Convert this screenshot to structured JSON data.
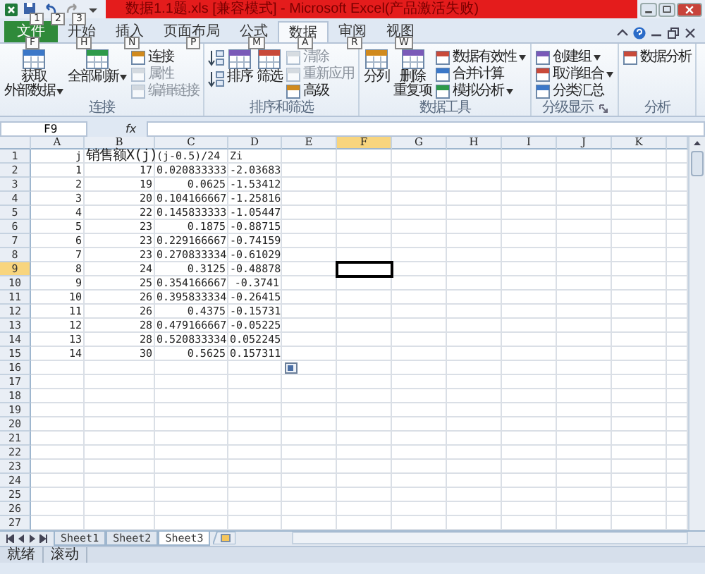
{
  "window": {
    "title": "数据1.1题.xls [兼容模式] - Microsoft Excel(产品激活失败)",
    "quick_access_keytips": [
      "1",
      "2",
      "3"
    ]
  },
  "ribbon_tabs": [
    {
      "label": "文件",
      "keytip": "F",
      "selected": false,
      "kind": "file"
    },
    {
      "label": "开始",
      "keytip": "H",
      "selected": false,
      "kind": "tab"
    },
    {
      "label": "插入",
      "keytip": "N",
      "selected": false,
      "kind": "tab"
    },
    {
      "label": "页面布局",
      "keytip": "P",
      "selected": false,
      "kind": "tab"
    },
    {
      "label": "公式",
      "keytip": "M",
      "selected": false,
      "kind": "tab"
    },
    {
      "label": "数据",
      "keytip": "A",
      "selected": true,
      "kind": "tab"
    },
    {
      "label": "审阅",
      "keytip": "R",
      "selected": false,
      "kind": "tab"
    },
    {
      "label": "视图",
      "keytip": "W",
      "selected": false,
      "kind": "tab"
    }
  ],
  "ribbon_groups": [
    {
      "label": "连接",
      "launcher": false,
      "items": [
        {
          "kind": "large",
          "lines": [
            "获取",
            "外部数据"
          ],
          "dropdown": true,
          "disabled": false
        },
        {
          "kind": "large",
          "lines": [
            "全部刷新"
          ],
          "dropdown": true,
          "disabled": false
        },
        {
          "kind": "small",
          "lines": [
            "连接"
          ],
          "dropdown": false,
          "disabled": false
        },
        {
          "kind": "small",
          "lines": [
            "属性"
          ],
          "dropdown": false,
          "disabled": true
        },
        {
          "kind": "small",
          "lines": [
            "编辑链接"
          ],
          "dropdown": false,
          "disabled": true
        }
      ]
    },
    {
      "label": "排序和筛选",
      "launcher": false,
      "items": [
        {
          "kind": "icon"
        },
        {
          "kind": "icon"
        },
        {
          "kind": "large",
          "lines": [
            "排序"
          ],
          "dropdown": false,
          "disabled": false
        },
        {
          "kind": "large",
          "lines": [
            "筛选"
          ],
          "dropdown": false,
          "disabled": false
        },
        {
          "kind": "small",
          "lines": [
            "清除"
          ],
          "dropdown": false,
          "disabled": true
        },
        {
          "kind": "small",
          "lines": [
            "重新应用"
          ],
          "dropdown": false,
          "disabled": true
        },
        {
          "kind": "small",
          "lines": [
            "高级"
          ],
          "dropdown": false,
          "disabled": false
        }
      ]
    },
    {
      "label": "数据工具",
      "launcher": false,
      "items": [
        {
          "kind": "large",
          "lines": [
            "分列"
          ],
          "dropdown": false,
          "disabled": false
        },
        {
          "kind": "large",
          "lines": [
            "删除",
            "重复项"
          ],
          "dropdown": false,
          "disabled": false
        },
        {
          "kind": "small",
          "lines": [
            "数据有效性"
          ],
          "dropdown": true,
          "disabled": false
        },
        {
          "kind": "small",
          "lines": [
            "合并计算"
          ],
          "dropdown": false,
          "disabled": false
        },
        {
          "kind": "small",
          "lines": [
            "模拟分析"
          ],
          "dropdown": true,
          "disabled": false
        }
      ]
    },
    {
      "label": "分级显示",
      "launcher": true,
      "items": [
        {
          "kind": "small",
          "lines": [
            "创建组"
          ],
          "dropdown": true,
          "disabled": false
        },
        {
          "kind": "small",
          "lines": [
            "取消组合"
          ],
          "dropdown": true,
          "disabled": false
        },
        {
          "kind": "small",
          "lines": [
            "分类汇总"
          ],
          "dropdown": false,
          "disabled": false
        }
      ]
    },
    {
      "label": "分析",
      "launcher": false,
      "items": [
        {
          "kind": "small",
          "lines": [
            "数据分析"
          ],
          "dropdown": false,
          "disabled": false
        }
      ]
    }
  ],
  "formula_bar": {
    "name_box": "F9",
    "function_label": "fx"
  },
  "sheet": {
    "columns": [
      {
        "label": "A",
        "selected": false
      },
      {
        "label": "B",
        "selected": false
      },
      {
        "label": "C",
        "selected": false
      },
      {
        "label": "D",
        "selected": false
      },
      {
        "label": "E",
        "selected": false
      },
      {
        "label": "F",
        "selected": true
      },
      {
        "label": "G",
        "selected": false
      },
      {
        "label": "H",
        "selected": false
      },
      {
        "label": "I",
        "selected": false
      },
      {
        "label": "J",
        "selected": false
      },
      {
        "label": "K",
        "selected": false
      }
    ],
    "rows": [
      {
        "header": "1",
        "selected": false,
        "cells": [
          {
            "text": "j",
            "kind": "value"
          },
          {
            "text": "销售额X(j)",
            "kind": "label"
          },
          {
            "text": "(j-0.5)/24",
            "kind": "label"
          },
          {
            "text": "Zi",
            "kind": "label"
          }
        ]
      },
      {
        "header": "2",
        "selected": false,
        "cells": [
          {
            "text": "1",
            "kind": "value"
          },
          {
            "text": "17",
            "kind": "value"
          },
          {
            "text": "0.020833333",
            "kind": "value"
          },
          {
            "text": "-2.03683",
            "kind": "value"
          }
        ]
      },
      {
        "header": "3",
        "selected": false,
        "cells": [
          {
            "text": "2",
            "kind": "value"
          },
          {
            "text": "19",
            "kind": "value"
          },
          {
            "text": "0.0625",
            "kind": "value"
          },
          {
            "text": "-1.53412",
            "kind": "value"
          }
        ]
      },
      {
        "header": "4",
        "selected": false,
        "cells": [
          {
            "text": "3",
            "kind": "value"
          },
          {
            "text": "20",
            "kind": "value"
          },
          {
            "text": "0.104166667",
            "kind": "value"
          },
          {
            "text": "-1.25816",
            "kind": "value"
          }
        ]
      },
      {
        "header": "5",
        "selected": false,
        "cells": [
          {
            "text": "4",
            "kind": "value"
          },
          {
            "text": "22",
            "kind": "value"
          },
          {
            "text": "0.145833333",
            "kind": "value"
          },
          {
            "text": "-1.05447",
            "kind": "value"
          }
        ]
      },
      {
        "header": "6",
        "selected": false,
        "cells": [
          {
            "text": "5",
            "kind": "value"
          },
          {
            "text": "23",
            "kind": "value"
          },
          {
            "text": "0.1875",
            "kind": "value"
          },
          {
            "text": "-0.88715",
            "kind": "value"
          }
        ]
      },
      {
        "header": "7",
        "selected": false,
        "cells": [
          {
            "text": "6",
            "kind": "value"
          },
          {
            "text": "23",
            "kind": "value"
          },
          {
            "text": "0.229166667",
            "kind": "value"
          },
          {
            "text": "-0.74159",
            "kind": "value"
          }
        ]
      },
      {
        "header": "8",
        "selected": false,
        "cells": [
          {
            "text": "7",
            "kind": "value"
          },
          {
            "text": "23",
            "kind": "value"
          },
          {
            "text": "0.270833334",
            "kind": "value"
          },
          {
            "text": "-0.61029",
            "kind": "value"
          }
        ]
      },
      {
        "header": "9",
        "selected": true,
        "cells": [
          {
            "text": "8",
            "kind": "value"
          },
          {
            "text": "24",
            "kind": "value"
          },
          {
            "text": "0.3125",
            "kind": "value"
          },
          {
            "text": "-0.48878",
            "kind": "value"
          }
        ]
      },
      {
        "header": "10",
        "selected": false,
        "cells": [
          {
            "text": "9",
            "kind": "value"
          },
          {
            "text": "25",
            "kind": "value"
          },
          {
            "text": "0.354166667",
            "kind": "value"
          },
          {
            "text": "-0.3741",
            "kind": "value"
          }
        ]
      },
      {
        "header": "11",
        "selected": false,
        "cells": [
          {
            "text": "10",
            "kind": "value"
          },
          {
            "text": "26",
            "kind": "value"
          },
          {
            "text": "0.395833334",
            "kind": "value"
          },
          {
            "text": "-0.26415",
            "kind": "value"
          }
        ]
      },
      {
        "header": "12",
        "selected": false,
        "cells": [
          {
            "text": "11",
            "kind": "value"
          },
          {
            "text": "26",
            "kind": "value"
          },
          {
            "text": "0.4375",
            "kind": "value"
          },
          {
            "text": "-0.15731",
            "kind": "value"
          }
        ]
      },
      {
        "header": "13",
        "selected": false,
        "cells": [
          {
            "text": "12",
            "kind": "value"
          },
          {
            "text": "28",
            "kind": "value"
          },
          {
            "text": "0.479166667",
            "kind": "value"
          },
          {
            "text": "-0.05225",
            "kind": "value"
          }
        ]
      },
      {
        "header": "14",
        "selected": false,
        "cells": [
          {
            "text": "13",
            "kind": "value"
          },
          {
            "text": "28",
            "kind": "value"
          },
          {
            "text": "0.520833334",
            "kind": "value"
          },
          {
            "text": "0.052245",
            "kind": "value"
          }
        ]
      },
      {
        "header": "15",
        "selected": false,
        "cells": [
          {
            "text": "14",
            "kind": "value"
          },
          {
            "text": "30",
            "kind": "value"
          },
          {
            "text": "0.5625",
            "kind": "value"
          },
          {
            "text": "0.157311",
            "kind": "value"
          }
        ]
      },
      {
        "header": "16",
        "selected": false,
        "cells": []
      },
      {
        "header": "17",
        "selected": false,
        "cells": []
      },
      {
        "header": "18",
        "selected": false,
        "cells": []
      },
      {
        "header": "19",
        "selected": false,
        "cells": []
      },
      {
        "header": "20",
        "selected": false,
        "cells": []
      },
      {
        "header": "21",
        "selected": false,
        "cells": []
      },
      {
        "header": "22",
        "selected": false,
        "cells": []
      },
      {
        "header": "23",
        "selected": false,
        "cells": []
      },
      {
        "header": "24",
        "selected": false,
        "cells": []
      },
      {
        "header": "25",
        "selected": false,
        "cells": []
      },
      {
        "header": "26",
        "selected": false,
        "cells": []
      },
      {
        "header": "27",
        "selected": false,
        "cells": []
      }
    ]
  },
  "sheet_tabs": [
    {
      "label": "Sheet1",
      "selected": false
    },
    {
      "label": "Sheet2",
      "selected": false
    },
    {
      "label": "Sheet3",
      "selected": true
    }
  ],
  "status_bar": {
    "items": [
      "就绪",
      "滚动"
    ]
  }
}
